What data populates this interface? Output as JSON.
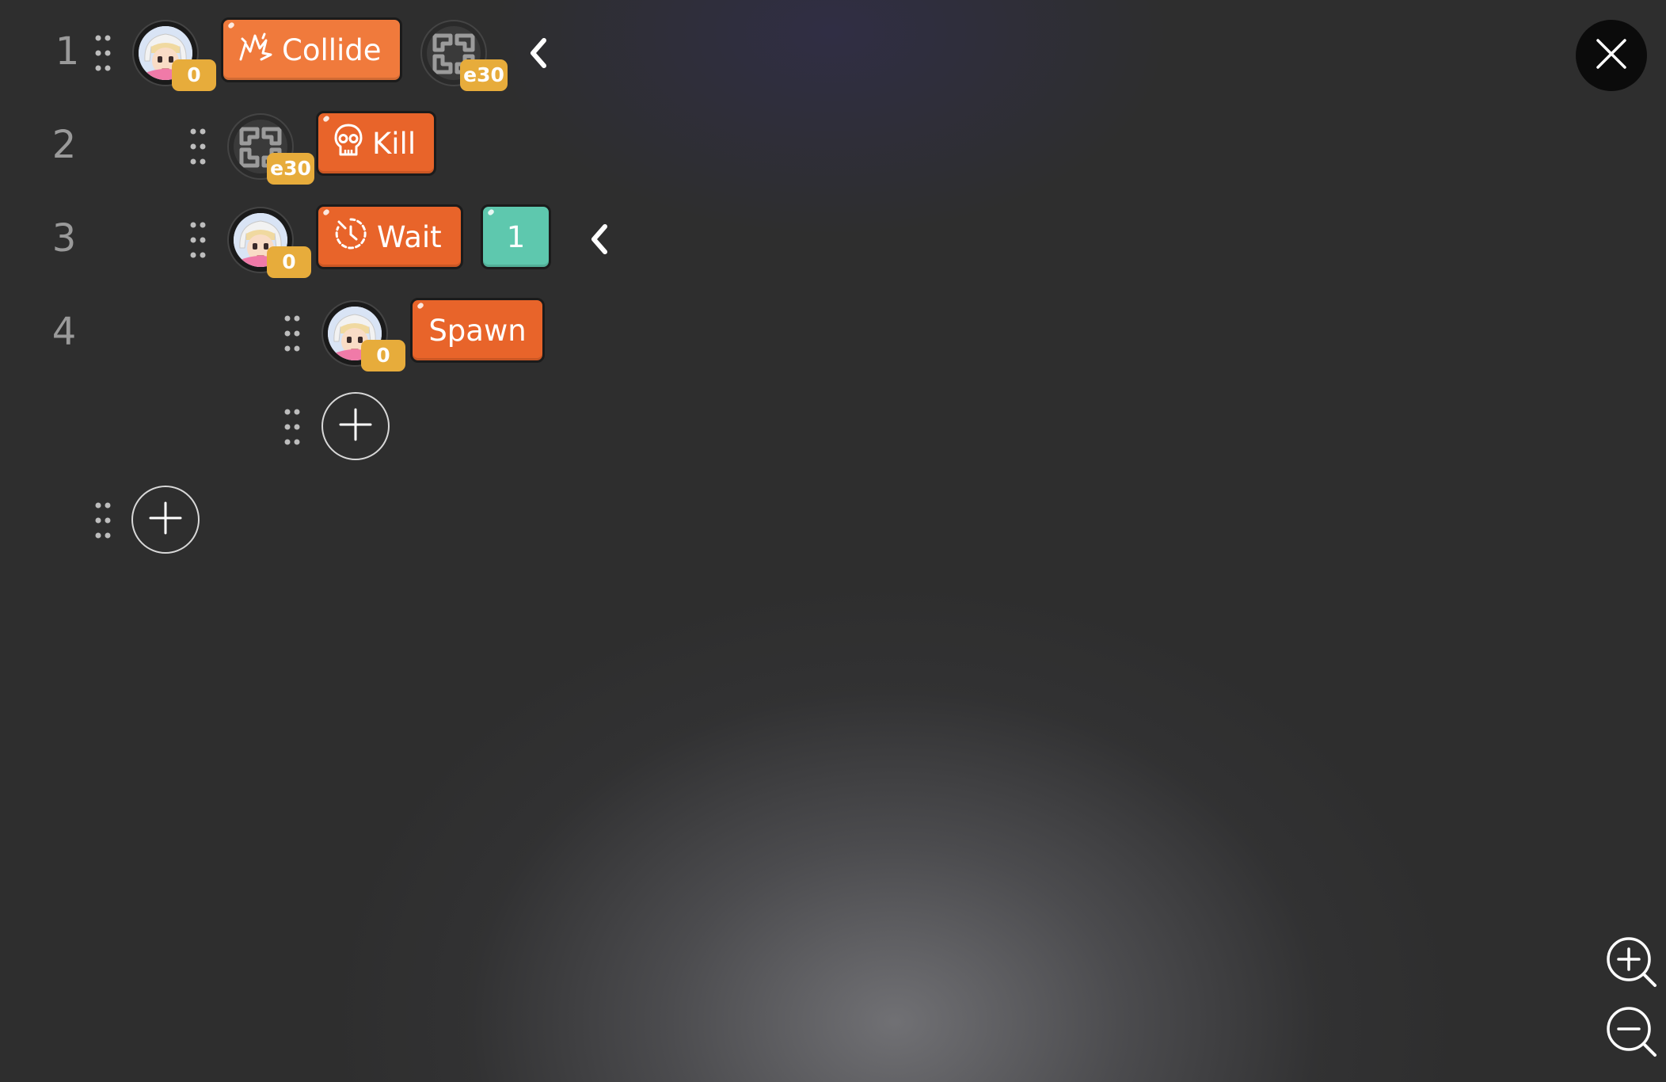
{
  "lines": [
    {
      "number": "1",
      "avatar_badge": "0",
      "block": "Collide",
      "block_icon": "collision-icon",
      "target_badge": "e30"
    },
    {
      "number": "2",
      "target_badge": "e30",
      "block": "Kill",
      "block_icon": "skull-icon"
    },
    {
      "number": "3",
      "avatar_badge": "0",
      "block": "Wait",
      "block_icon": "timer-icon",
      "value": "1"
    },
    {
      "number": "4",
      "avatar_badge": "0",
      "block": "Spawn"
    }
  ],
  "icons": {
    "close": "close-icon",
    "zoom_in": "zoom-in-icon",
    "zoom_out": "zoom-out-icon",
    "add": "plus-icon",
    "collapse": "chevron-left-icon",
    "drag": "drag-handle-icon"
  },
  "colors": {
    "background": "#2e2e2e",
    "action_block": "#e8642a",
    "event_block": "#f07a3c",
    "number_block": "#5ec8ae",
    "badge": "#e7ac3b",
    "line_number": "#9a9a9a"
  }
}
